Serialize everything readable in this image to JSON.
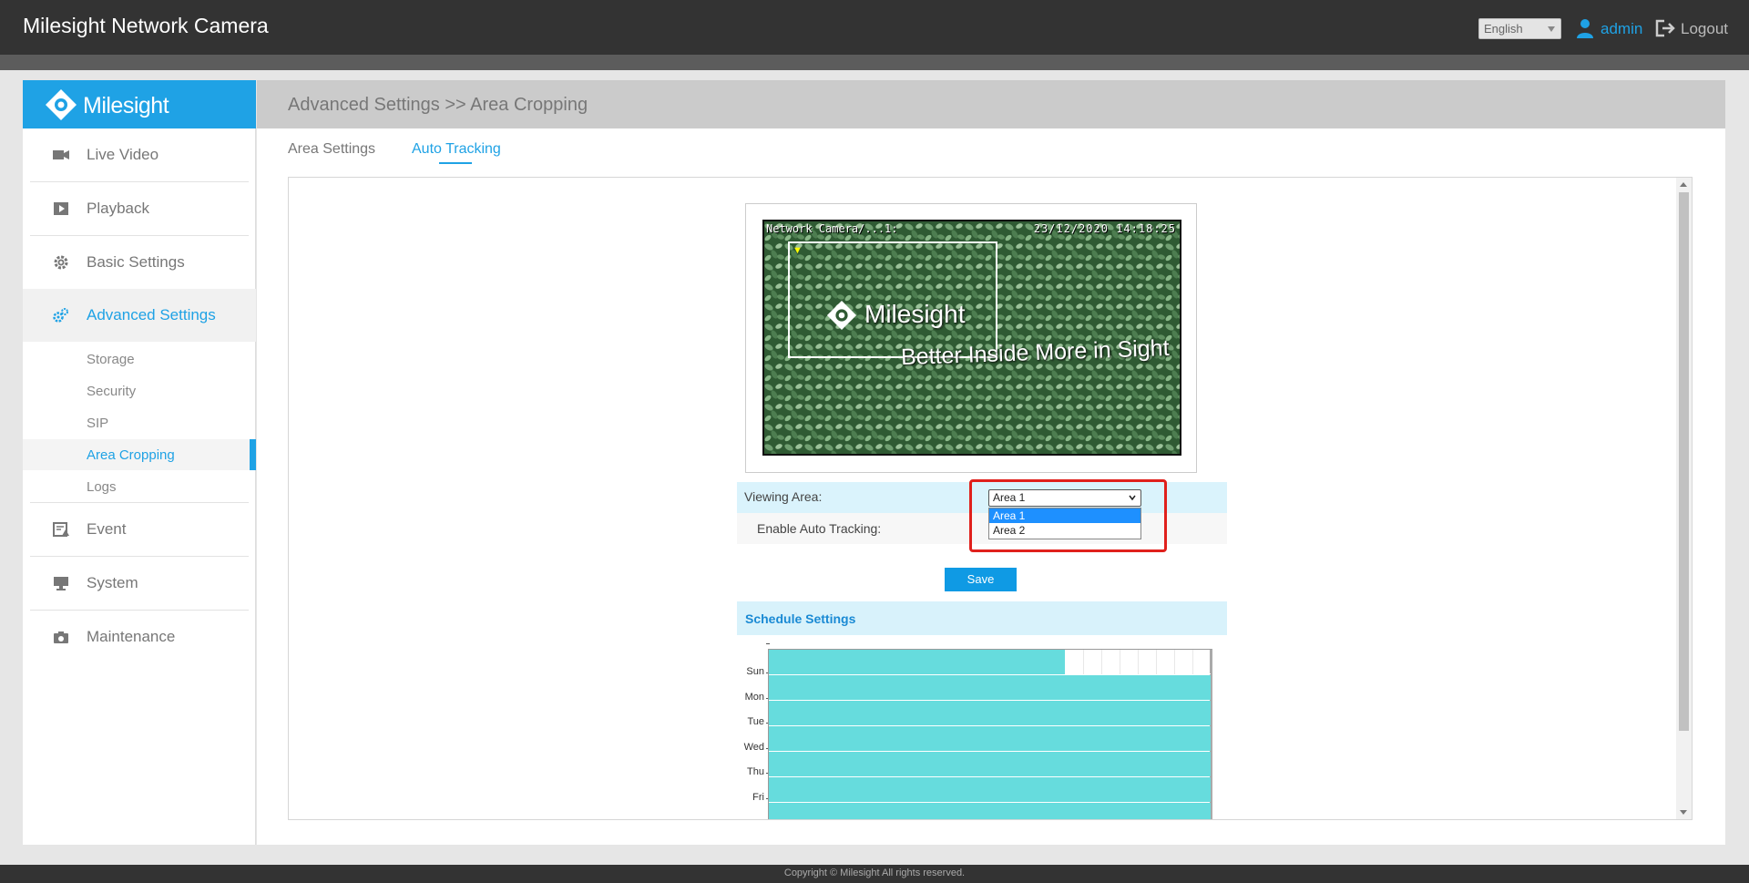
{
  "header": {
    "app_title": "Milesight Network Camera",
    "language": "English",
    "username": "admin",
    "logout_label": "Logout"
  },
  "sidebar": {
    "brand": "Milesight",
    "items": [
      {
        "label": "Live Video",
        "icon": "video-camera-icon"
      },
      {
        "label": "Playback",
        "icon": "playback-icon"
      },
      {
        "label": "Basic Settings",
        "icon": "gear-icon"
      },
      {
        "label": "Advanced Settings",
        "icon": "gears-icon"
      },
      {
        "label": "Event",
        "icon": "event-icon"
      },
      {
        "label": "System",
        "icon": "monitor-icon"
      },
      {
        "label": "Maintenance",
        "icon": "camera-icon"
      }
    ],
    "subitems": [
      "Storage",
      "Security",
      "SIP",
      "Area Cropping",
      "Logs"
    ]
  },
  "main": {
    "breadcrumb": "Advanced Settings >> Area Cropping",
    "tabs": [
      "Area Settings",
      "Auto Tracking"
    ]
  },
  "video": {
    "osd_title": "Network Camera/...1:",
    "osd_datetime": "23/12/2020 14:18:25",
    "watermark_brand": "Milesight",
    "watermark_slogan": "Better Inside More in Sight"
  },
  "form": {
    "viewing_area_label": "Viewing Area:",
    "viewing_area_value": "Area 1",
    "viewing_area_options": [
      "Area 1",
      "Area 2"
    ],
    "auto_tracking_label": "Enable Auto Tracking:",
    "save_label": "Save"
  },
  "schedule": {
    "title": "Schedule Settings",
    "days": [
      "Sun",
      "Mon",
      "Tue",
      "Wed",
      "Thu",
      "Fri"
    ]
  },
  "footer": {
    "copyright": "Copyright © Milesight All rights reserved."
  },
  "colors": {
    "accent": "#1fa2e5",
    "schedule_fill": "#66dcdd",
    "highlight_red": "#e0201c"
  }
}
